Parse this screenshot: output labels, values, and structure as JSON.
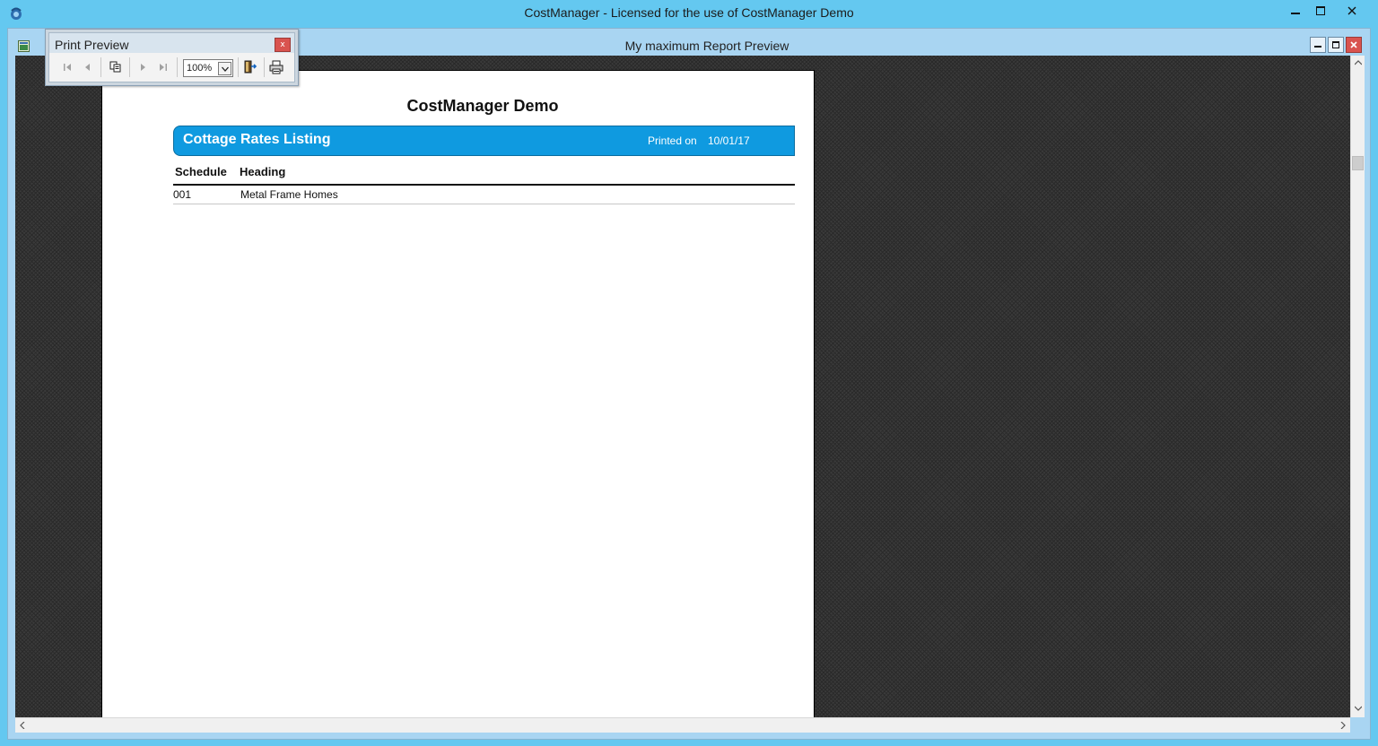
{
  "app": {
    "title": "CostManager - Licensed for the use of CostManager Demo",
    "window_controls": [
      "minimize",
      "maximize",
      "close"
    ]
  },
  "child_window": {
    "title": "My maximum Report Preview"
  },
  "toolbar": {
    "title": "Print Preview",
    "close_label": "x",
    "zoom_value": "100%",
    "buttons": [
      "first-page",
      "previous-page",
      "copy",
      "next-page",
      "last-page",
      "exit",
      "print"
    ]
  },
  "report": {
    "company": "CostManager Demo",
    "banner_title": "Cottage Rates Listing",
    "printed_label": "Printed on",
    "printed_date": "10/01/17",
    "columns": [
      "Schedule",
      "Heading"
    ],
    "rows": [
      {
        "schedule": "001",
        "heading": "Metal Frame Homes"
      }
    ]
  },
  "colors": {
    "titlebar": "#64c8f0",
    "banner": "#0f9ae0"
  }
}
